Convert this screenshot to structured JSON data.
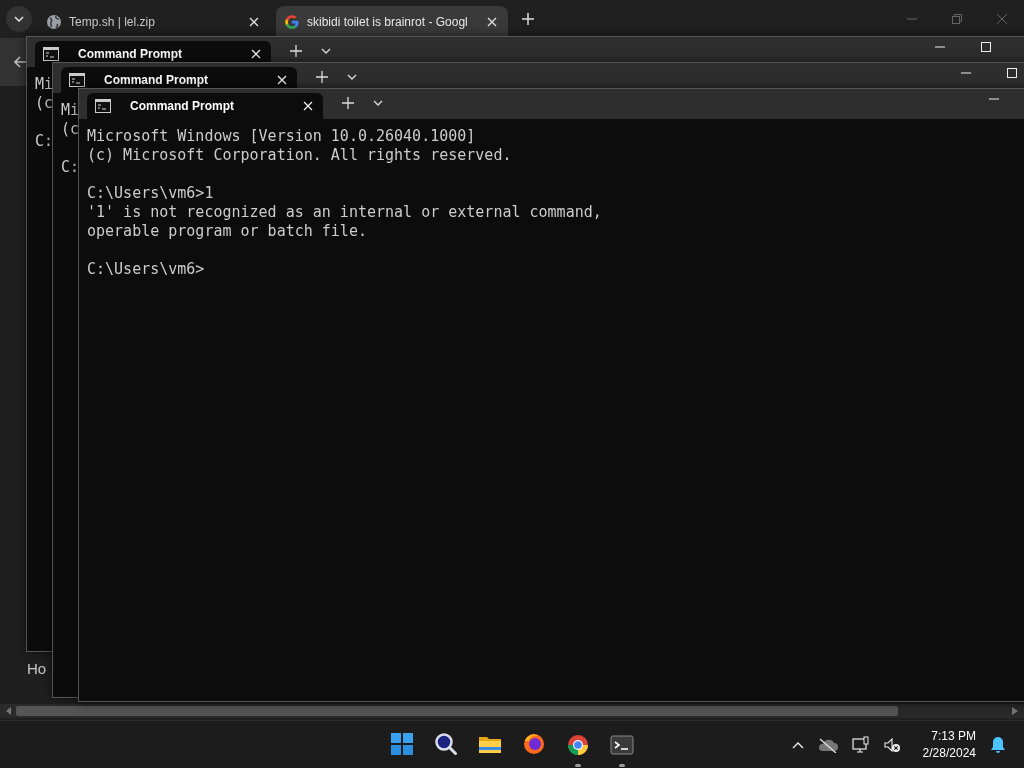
{
  "browser": {
    "tabs": [
      {
        "title": "Temp.sh | lel.zip",
        "selected": false
      },
      {
        "title": "skibidi toilet is brainrot - Googl",
        "selected": true
      }
    ],
    "page_text": "Ho"
  },
  "terminals": [
    {
      "tab_title": "Command Prompt",
      "blocks": [
        [
          "Mi",
          "(c"
        ],
        [
          "C:"
        ]
      ]
    },
    {
      "tab_title": "Command Prompt",
      "blocks": [
        [
          "Mi",
          "(c"
        ],
        [
          "C:"
        ]
      ]
    },
    {
      "tab_title": "Command Prompt",
      "blocks": [
        [
          "Microsoft Windows [Version 10.0.26040.1000]",
          "(c) Microsoft Corporation. All rights reserved."
        ],
        [
          "C:\\Users\\vm6>1",
          "'1' is not recognized as an internal or external command,",
          "operable program or batch file."
        ],
        [
          "C:\\Users\\vm6>"
        ]
      ]
    }
  ],
  "taskbar": {
    "apps": [
      {
        "kind": "start",
        "running": false
      },
      {
        "kind": "search",
        "running": false
      },
      {
        "kind": "files",
        "running": false
      },
      {
        "kind": "firefox",
        "running": false
      },
      {
        "kind": "chrome",
        "running": true
      },
      {
        "kind": "terminal",
        "running": true
      }
    ],
    "time": "7:13 PM",
    "date": "2/28/2024"
  }
}
